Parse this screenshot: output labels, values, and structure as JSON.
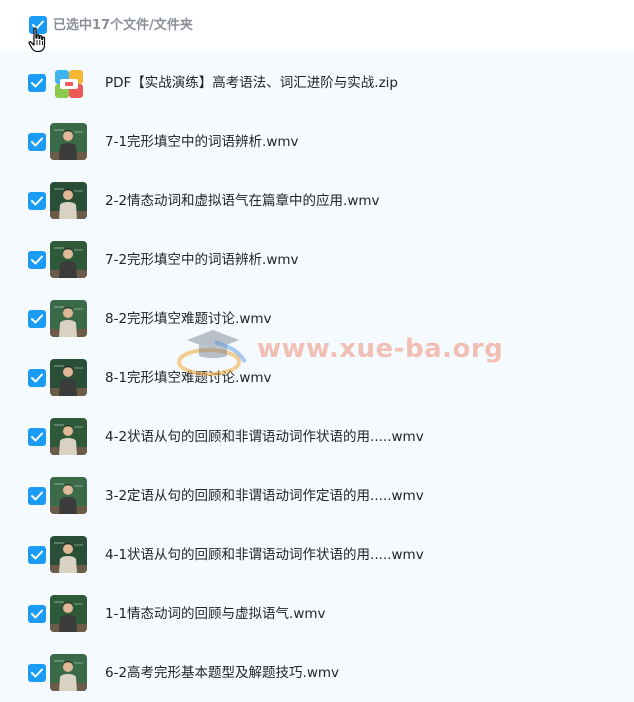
{
  "header": {
    "select_all_checked": true,
    "title": "已选中17个文件/文件夹"
  },
  "watermark": {
    "text": "www.xue-ba.org"
  },
  "files": [
    {
      "name": "PDF【实战演练】高考语法、词汇进阶与实战.zip",
      "checked": true,
      "icon": "zip-archive-icon",
      "kind": "zip"
    },
    {
      "name": "7-1完形填空中的词语辨析.wmv",
      "checked": true,
      "icon": "video-thumbnail",
      "kind": "video"
    },
    {
      "name": "2-2情态动词和虚拟语气在篇章中的应用.wmv",
      "checked": true,
      "icon": "video-thumbnail",
      "kind": "video"
    },
    {
      "name": "7-2完形填空中的词语辨析.wmv",
      "checked": true,
      "icon": "video-thumbnail",
      "kind": "video"
    },
    {
      "name": "8-2完形填空难题讨论.wmv",
      "checked": true,
      "icon": "video-thumbnail",
      "kind": "video"
    },
    {
      "name": "8-1完形填空难题讨论.wmv",
      "checked": true,
      "icon": "video-thumbnail",
      "kind": "video"
    },
    {
      "name": "4-2状语从句的回顾和非谓语动词作状语的用.....wmv",
      "checked": true,
      "icon": "video-thumbnail",
      "kind": "video"
    },
    {
      "name": "3-2定语从句的回顾和非谓语动词作定语的用.....wmv",
      "checked": true,
      "icon": "video-thumbnail",
      "kind": "video"
    },
    {
      "name": "4-1状语从句的回顾和非谓语动词作状语的用.....wmv",
      "checked": true,
      "icon": "video-thumbnail",
      "kind": "video"
    },
    {
      "name": "1-1情态动词的回顾与虚拟语气.wmv",
      "checked": true,
      "icon": "video-thumbnail",
      "kind": "video"
    },
    {
      "name": "6-2高考完形基本题型及解题技巧.wmv",
      "checked": true,
      "icon": "video-thumbnail",
      "kind": "video"
    }
  ]
}
